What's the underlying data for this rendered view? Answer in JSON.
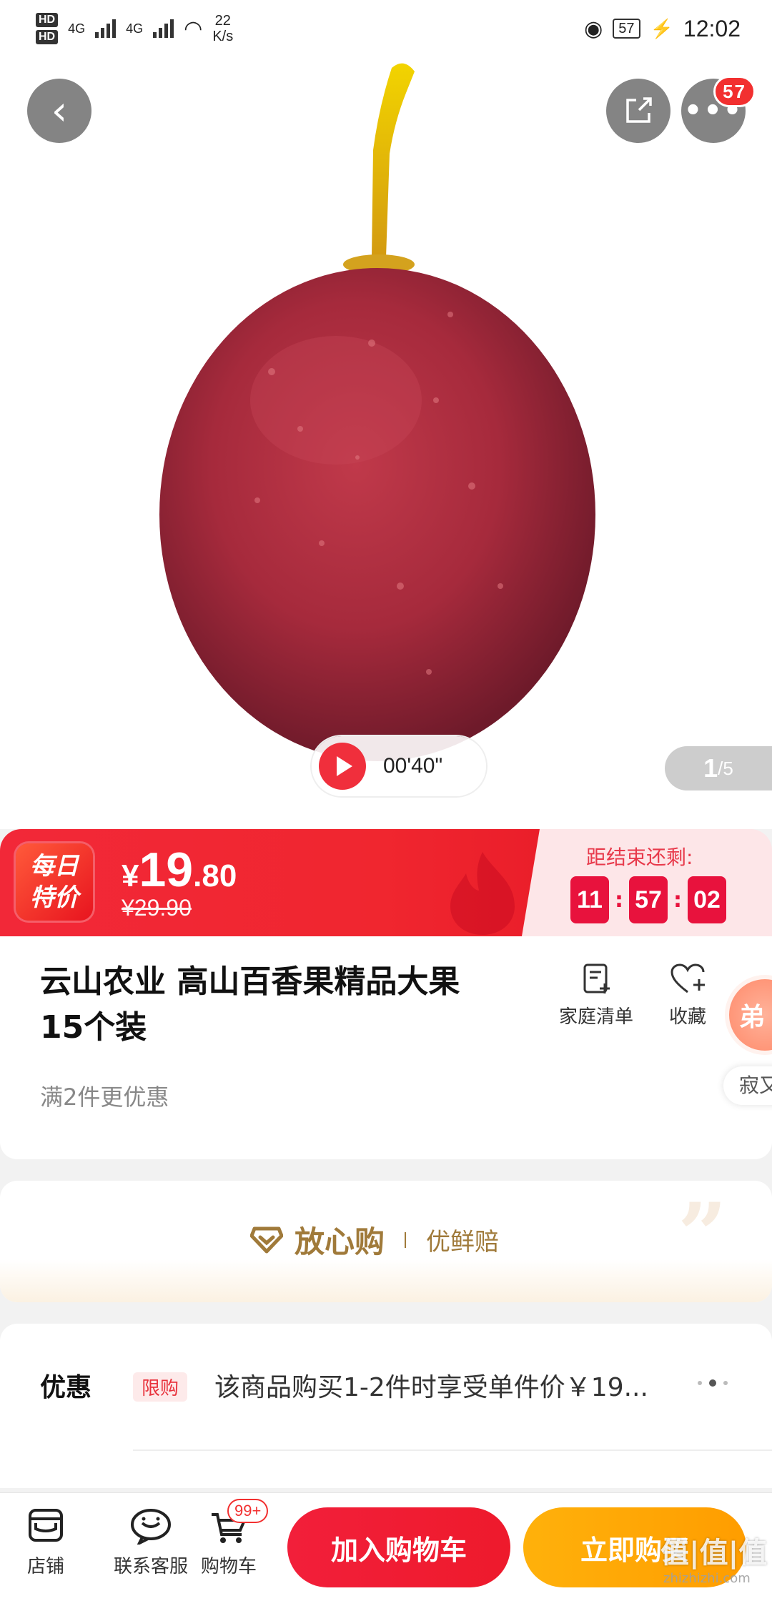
{
  "status_bar": {
    "hd1": "HD",
    "hd2": "HD",
    "net1": "4G",
    "net2": "4G",
    "speed_value": "22",
    "speed_unit": "K/s",
    "battery": "57",
    "time": "12:02"
  },
  "header": {
    "more_badge": "57"
  },
  "hero": {
    "video_duration": "00'40\"",
    "pager_current": "1",
    "pager_total": "/5"
  },
  "price": {
    "tag_line1": "每日",
    "tag_line2": "特价",
    "currency": "¥",
    "integer": "19",
    "decimal": ".80",
    "original": "¥29.90",
    "countdown_label": "距结束还剩:",
    "countdown": [
      "11",
      "57",
      "02"
    ]
  },
  "product": {
    "title": "云山农业 高山百香果精品大果 15个装",
    "promo": "满2件更优惠",
    "action_list": "家庭清单",
    "action_fav": "收藏",
    "side_float": "弟",
    "side_label": "寂又"
  },
  "assurance": {
    "main": "放心购",
    "sub": "优鲜赔"
  },
  "discount": {
    "label": "优惠",
    "tag": "限购",
    "text": "该商品购买1-2件时享受单件价￥19..."
  },
  "bottom": {
    "store": "店铺",
    "service": "联系客服",
    "cart": "购物车",
    "cart_badge": "99+",
    "add_cart": "加入购物车",
    "buy_now": "立即购买",
    "watermark": "值|值|值",
    "watermark_site": "zhizhizhi.com"
  },
  "colors": {
    "accent_red": "#f0262f",
    "accent_orange": "#ff9d00",
    "gold": "#a07a3a"
  }
}
